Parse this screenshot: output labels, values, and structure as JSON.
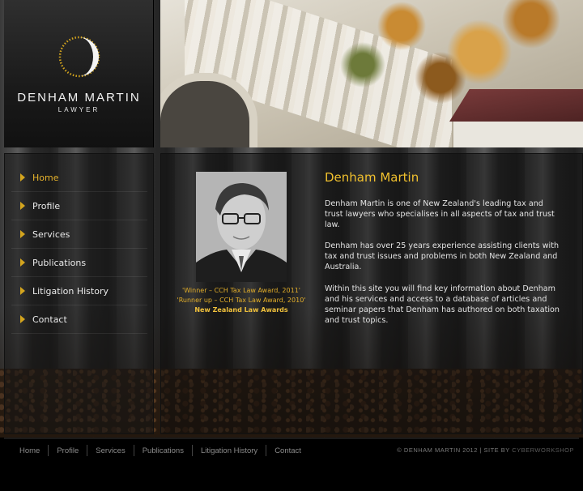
{
  "logo": {
    "name": "DENHAM MARTIN",
    "subtitle": "LAWYER"
  },
  "nav": {
    "items": [
      {
        "label": "Home",
        "active": true
      },
      {
        "label": "Profile",
        "active": false
      },
      {
        "label": "Services",
        "active": false
      },
      {
        "label": "Publications",
        "active": false
      },
      {
        "label": "Litigation History",
        "active": false
      },
      {
        "label": "Contact",
        "active": false
      }
    ]
  },
  "content": {
    "heading": "Denham Martin",
    "paragraphs": [
      "Denham Martin is one of New Zealand's leading tax and trust lawyers who specialises in all aspects of tax and trust law.",
      "Denham has over 25 years experience assisting clients with tax and trust issues and problems in both New Zealand and Australia.",
      "Within this site you will find key information about Denham and his services and access to a database of articles and seminar papers that Denham has authored on both taxation and trust topics."
    ],
    "awards": [
      "'Winner – CCH Tax Law Award, 2011'",
      "'Runner up – CCH Tax Law Award, 2010'",
      "New Zealand Law Awards"
    ]
  },
  "footer": {
    "links": [
      "Home",
      "Profile",
      "Services",
      "Publications",
      "Litigation History",
      "Contact"
    ],
    "copyright": "© DENHAM MARTIN 2012 | SITE BY ",
    "site_by": "CYBERWORKSHOP"
  },
  "colors": {
    "accent": "#e5b22c",
    "text": "#e4e4e4",
    "footer_text": "#8a8a8a"
  }
}
